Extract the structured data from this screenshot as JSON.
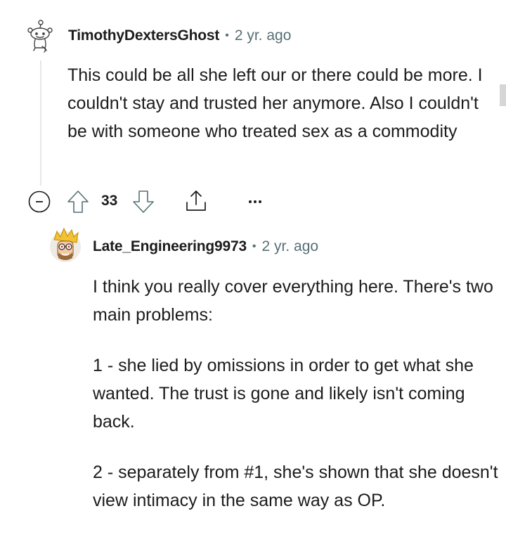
{
  "comments": [
    {
      "author": "TimothyDextersGhost",
      "separator": "•",
      "time": "2 yr. ago",
      "body": "This could be all she left our or there could be more. I couldn't stay and trusted her anymore. Also I couldn't be with someone who treated sex as a commodity",
      "score": "33"
    },
    {
      "author": "Late_Engineering9973",
      "separator": "•",
      "time": "2 yr. ago",
      "paragraphs": [
        "I think you really cover everything here. There's two main problems:",
        "1 - she lied by omissions in order to get what she wanted. The trust is gone and likely isn't coming back.",
        "2 - separately from #1, she's shown that she doesn't view intimacy in the same way as OP."
      ]
    }
  ],
  "icons": {
    "collapse": "minus-circle-icon",
    "upvote": "arrow-up-icon",
    "downvote": "arrow-down-icon",
    "share": "share-icon",
    "more": "ellipsis-icon"
  },
  "colors": {
    "text": "#1c1c1c",
    "meta": "#576f76",
    "thread_line": "#e5e7e8"
  }
}
